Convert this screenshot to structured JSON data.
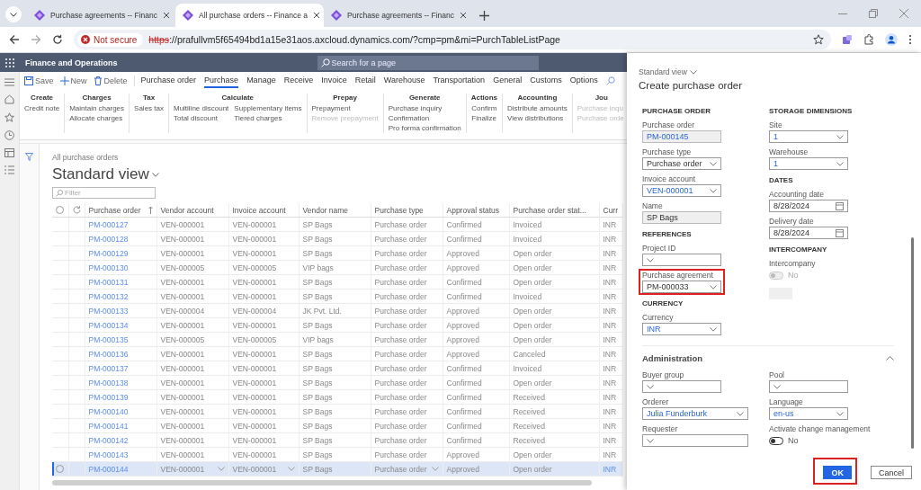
{
  "browser": {
    "tabs": [
      {
        "title": "Purchase agreements -- Financ",
        "selected": false
      },
      {
        "title": "All purchase orders -- Finance a",
        "selected": true
      },
      {
        "title": "Purchase agreements -- Financ",
        "selected": false
      }
    ],
    "security": "Not secure",
    "url_scheme": "https",
    "url_rest": "://prafullvm5f65494bd1a15e31aos.axcloud.dynamics.com/?cmp=pm&mi=PurchTableListPage"
  },
  "app": {
    "title": "Finance and Operations",
    "search_placeholder": "Search for a page"
  },
  "action_pane": {
    "commands": [
      {
        "label": "Save",
        "disabled": false
      },
      {
        "label": "New",
        "disabled": false
      },
      {
        "label": "Delete",
        "disabled": false
      }
    ],
    "tabs": [
      {
        "label": "Purchase order",
        "selected": false
      },
      {
        "label": "Purchase",
        "selected": true
      },
      {
        "label": "Manage",
        "selected": false
      },
      {
        "label": "Receive",
        "selected": false
      },
      {
        "label": "Invoice",
        "selected": false
      },
      {
        "label": "Retail",
        "selected": false
      },
      {
        "label": "Warehouse",
        "selected": false
      },
      {
        "label": "Transportation",
        "selected": false
      },
      {
        "label": "General",
        "selected": false
      },
      {
        "label": "Customs",
        "selected": false
      },
      {
        "label": "Options",
        "selected": false
      }
    ]
  },
  "ribbon": {
    "groups": [
      {
        "title": "Create",
        "columns": [
          [
            {
              "label": "Credit note",
              "disabled": false
            }
          ]
        ]
      },
      {
        "title": "Charges",
        "columns": [
          [
            {
              "label": "Maintain charges",
              "disabled": false
            },
            {
              "label": "Allocate charges",
              "disabled": false
            }
          ]
        ]
      },
      {
        "title": "Tax",
        "columns": [
          [
            {
              "label": "Sales tax",
              "disabled": false
            }
          ]
        ]
      },
      {
        "title": "Calculate",
        "columns": [
          [
            {
              "label": "Multiline discount",
              "disabled": false
            },
            {
              "label": "Total discount",
              "disabled": false
            }
          ],
          [
            {
              "label": "Supplementary items",
              "disabled": false
            },
            {
              "label": "Tiered charges",
              "disabled": false
            }
          ]
        ]
      },
      {
        "title": "Prepay",
        "columns": [
          [
            {
              "label": "Prepayment",
              "disabled": false
            },
            {
              "label": "Remove prepayment",
              "disabled": true
            }
          ]
        ]
      },
      {
        "title": "Generate",
        "columns": [
          [
            {
              "label": "Purchase inquiry",
              "disabled": false
            },
            {
              "label": "Confirmation",
              "disabled": false
            },
            {
              "label": "Pro forma confirmation",
              "disabled": false
            }
          ]
        ]
      },
      {
        "title": "Actions",
        "columns": [
          [
            {
              "label": "Confirm",
              "disabled": false
            },
            {
              "label": "Finalize",
              "disabled": false
            }
          ]
        ]
      },
      {
        "title": "Accounting",
        "columns": [
          [
            {
              "label": "Distribute amounts",
              "disabled": false
            },
            {
              "label": "View distributions",
              "disabled": false
            }
          ]
        ]
      },
      {
        "title": "Jou",
        "columns": [
          [
            {
              "label": "Purchase inqu",
              "disabled": true
            },
            {
              "label": "Purchase orde",
              "disabled": true
            }
          ]
        ]
      }
    ]
  },
  "page": {
    "breadcrumb": "All purchase orders",
    "view": "Standard view",
    "filter_placeholder": "Filter",
    "table": {
      "columns": [
        {
          "label": "Purchase order",
          "sorted": true,
          "editable": false,
          "link": true
        },
        {
          "label": "Vendor account",
          "sorted": false,
          "editable": true,
          "link": false
        },
        {
          "label": "Invoice account",
          "sorted": false,
          "editable": true,
          "link": false
        },
        {
          "label": "Vendor name",
          "sorted": false,
          "editable": false,
          "link": false
        },
        {
          "label": "Purchase type",
          "sorted": false,
          "editable": true,
          "link": false
        },
        {
          "label": "Approval status",
          "sorted": false,
          "editable": false,
          "link": false
        },
        {
          "label": "Purchase order stat...",
          "sorted": false,
          "editable": false,
          "link": false
        },
        {
          "label": "Curr",
          "sorted": false,
          "editable": false,
          "link": false
        }
      ],
      "rows": [
        {
          "cells": [
            "PM-000127",
            "VEN-000001",
            "VEN-000001",
            "SP Bags",
            "Purchase order",
            "Confirmed",
            "Invoiced",
            "INR"
          ],
          "selected": false
        },
        {
          "cells": [
            "PM-000128",
            "VEN-000001",
            "VEN-000001",
            "SP Bags",
            "Purchase order",
            "Confirmed",
            "Invoiced",
            "INR"
          ],
          "selected": false
        },
        {
          "cells": [
            "PM-000129",
            "VEN-000001",
            "VEN-000001",
            "SP Bags",
            "Purchase order",
            "Approved",
            "Open order",
            "INR"
          ],
          "selected": false
        },
        {
          "cells": [
            "PM-000130",
            "VEN-000005",
            "VEN-000005",
            "VIP bags",
            "Purchase order",
            "Approved",
            "Open order",
            "INR"
          ],
          "selected": false
        },
        {
          "cells": [
            "PM-000131",
            "VEN-000001",
            "VEN-000001",
            "SP Bags",
            "Purchase order",
            "Confirmed",
            "Open order",
            "INR"
          ],
          "selected": false
        },
        {
          "cells": [
            "PM-000132",
            "VEN-000001",
            "VEN-000001",
            "SP Bags",
            "Purchase order",
            "Confirmed",
            "Invoiced",
            "INR"
          ],
          "selected": false
        },
        {
          "cells": [
            "PM-000133",
            "VEN-000004",
            "VEN-000004",
            "JK Pvt. Ltd.",
            "Purchase order",
            "Approved",
            "Open order",
            "INR"
          ],
          "selected": false
        },
        {
          "cells": [
            "PM-000134",
            "VEN-000001",
            "VEN-000001",
            "SP Bags",
            "Purchase order",
            "Approved",
            "Open order",
            "INR"
          ],
          "selected": false
        },
        {
          "cells": [
            "PM-000135",
            "VEN-000005",
            "VEN-000005",
            "VIP bags",
            "Purchase order",
            "Approved",
            "Open order",
            "INR"
          ],
          "selected": false
        },
        {
          "cells": [
            "PM-000136",
            "VEN-000001",
            "VEN-000001",
            "SP Bags",
            "Purchase order",
            "Approved",
            "Canceled",
            "INR"
          ],
          "selected": false
        },
        {
          "cells": [
            "PM-000137",
            "VEN-000001",
            "VEN-000001",
            "SP Bags",
            "Purchase order",
            "Confirmed",
            "Invoiced",
            "INR"
          ],
          "selected": false
        },
        {
          "cells": [
            "PM-000138",
            "VEN-000001",
            "VEN-000001",
            "SP Bags",
            "Purchase order",
            "Confirmed",
            "Open order",
            "INR"
          ],
          "selected": false
        },
        {
          "cells": [
            "PM-000139",
            "VEN-000001",
            "VEN-000001",
            "SP Bags",
            "Purchase order",
            "Confirmed",
            "Received",
            "INR"
          ],
          "selected": false
        },
        {
          "cells": [
            "PM-000140",
            "VEN-000001",
            "VEN-000001",
            "SP Bags",
            "Purchase order",
            "Confirmed",
            "Received",
            "INR"
          ],
          "selected": false
        },
        {
          "cells": [
            "PM-000141",
            "VEN-000001",
            "VEN-000001",
            "SP Bags",
            "Purchase order",
            "Confirmed",
            "Received",
            "INR"
          ],
          "selected": false
        },
        {
          "cells": [
            "PM-000142",
            "VEN-000001",
            "VEN-000001",
            "SP Bags",
            "Purchase order",
            "Confirmed",
            "Received",
            "INR"
          ],
          "selected": false
        },
        {
          "cells": [
            "PM-000143",
            "VEN-000001",
            "VEN-000001",
            "SP Bags",
            "Purchase order",
            "Approved",
            "Open order",
            "INR"
          ],
          "selected": false
        },
        {
          "cells": [
            "PM-000144",
            "VEN-000001",
            "VEN-000001",
            "SP Bags",
            "Purchase order",
            "Approved",
            "Open order",
            "INR"
          ],
          "selected": true
        }
      ]
    }
  },
  "panel": {
    "view": "Standard view",
    "title": "Create purchase order",
    "columns": [
      [
        {
          "heading": "PURCHASE ORDER",
          "fields": [
            {
              "label": "Purchase order",
              "kind": "readonly",
              "value": "PM-000145",
              "link": true,
              "highlighted": false
            },
            {
              "label": "Purchase type",
              "kind": "dropdown",
              "value": "Purchase order",
              "link": false,
              "highlighted": false
            },
            {
              "label": "Invoice account",
              "kind": "dropdown",
              "value": "VEN-000001",
              "link": true,
              "highlighted": false
            },
            {
              "label": "Name",
              "kind": "readonly",
              "value": "SP Bags",
              "link": false,
              "highlighted": false
            }
          ]
        },
        {
          "heading": "REFERENCES",
          "fields": [
            {
              "label": "Project ID",
              "kind": "dropdown",
              "highlighted": false
            },
            {
              "label": "Purchase agreement",
              "kind": "dropdown",
              "value": "PM-000033",
              "link": false,
              "highlighted": true
            }
          ]
        },
        {
          "heading": "CURRENCY",
          "fields": [
            {
              "label": "Currency",
              "kind": "dropdown",
              "value": "INR",
              "link": true,
              "highlighted": false
            }
          ]
        }
      ],
      [
        {
          "heading": "STORAGE DIMENSIONS",
          "fields": [
            {
              "label": "Site",
              "kind": "dropdown",
              "value": "1",
              "link": true,
              "highlighted": false
            },
            {
              "label": "Warehouse",
              "kind": "dropdown",
              "value": "1",
              "link": true,
              "highlighted": false
            }
          ]
        },
        {
          "heading": "DATES",
          "fields": [
            {
              "label": "Accounting date",
              "kind": "date",
              "value": "8/28/2024",
              "link": false,
              "highlighted": false
            },
            {
              "label": "Delivery date",
              "kind": "date",
              "value": "8/28/2024",
              "link": false,
              "highlighted": false
            }
          ]
        },
        {
          "heading": "INTERCOMPANY",
          "fields": [
            {
              "label": "Intercompany",
              "kind": "toggle",
              "value": "No",
              "on": false,
              "disabled": true,
              "highlighted": false
            },
            {
              "kind": "blank",
              "highlighted": false
            }
          ]
        }
      ]
    ],
    "admin": {
      "title": "Administration",
      "expanded": true,
      "columns": [
        [
          {
            "label": "Buyer group",
            "kind": "dropdown",
            "highlighted": false
          },
          {
            "label": "Orderer",
            "kind": "dropdown",
            "value": "Julia Funderburk",
            "link": true,
            "wide": true,
            "highlighted": false
          },
          {
            "label": "Requester",
            "kind": "dropdown",
            "wide": true,
            "highlighted": false
          }
        ],
        [
          {
            "label": "Pool",
            "kind": "dropdown",
            "highlighted": false
          },
          {
            "label": "Language",
            "kind": "dropdown",
            "value": "en-us",
            "link": true,
            "highlighted": false
          },
          {
            "label": "Activate change management",
            "kind": "toggle",
            "value": "No",
            "on": false,
            "disabled": false,
            "highlighted": false
          }
        ]
      ]
    },
    "buttons": [
      {
        "label": "OK",
        "primary": true,
        "highlighted": true
      },
      {
        "label": "Cancel",
        "primary": false,
        "highlighted": false
      }
    ]
  }
}
